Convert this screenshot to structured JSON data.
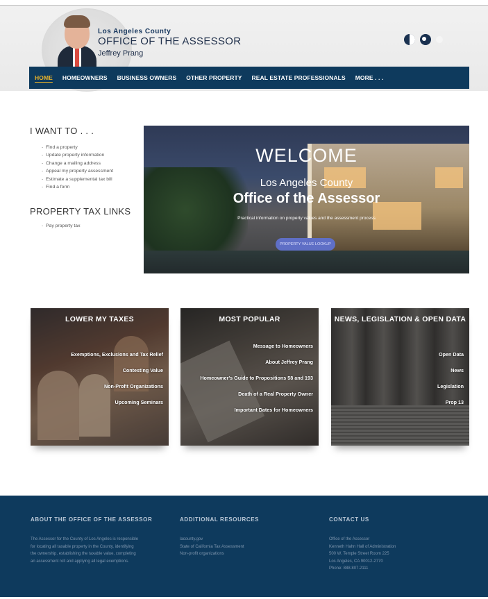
{
  "header": {
    "county": "Los Angeles County",
    "office": "OFFICE OF THE ASSESSOR",
    "assessor_name": "Jeffrey Prang"
  },
  "nav": {
    "items": [
      {
        "label": "HOME",
        "active": true
      },
      {
        "label": "HOMEOWNERS"
      },
      {
        "label": "BUSINESS OWNERS"
      },
      {
        "label": "OTHER PROPERTY"
      },
      {
        "label": "REAL ESTATE PROFESSIONALS"
      },
      {
        "label": "MORE . . ."
      }
    ]
  },
  "want_to": {
    "title": "I WANT TO . . .",
    "items": [
      "Find a property",
      "Update property information",
      "Change a mailing address",
      "Appeal my property assessment",
      "Estimate a supplemental tax bill",
      "Find a form"
    ]
  },
  "property_tax": {
    "title": "PROPERTY TAX LINKS",
    "items": [
      "Pay property tax"
    ]
  },
  "hero": {
    "welcome": "WELCOME",
    "county": "Los Angeles County",
    "office": "Office of the Assessor",
    "description": "Practical information on property values and the assessment process",
    "button": "PROPERTY VALUE LOOKUP"
  },
  "cards": [
    {
      "title": "LOWER MY TAXES",
      "links": [
        "Exemptions, Exclusions and Tax Relief",
        "Contesting Value",
        "Non-Profit Organizations",
        "Upcoming Seminars"
      ]
    },
    {
      "title": "MOST POPULAR",
      "links": [
        "Message to Homeowners",
        "About Jeffrey Prang",
        "Homeowner's Guide to Propositions 58 and 193",
        "Death of a Real Property Owner",
        "Important Dates for Homeowners"
      ]
    },
    {
      "title": "NEWS, LEGISLATION & OPEN DATA",
      "links": [
        "Open Data",
        "News",
        "Legislation",
        "Prop 13"
      ]
    }
  ],
  "footer": {
    "about": {
      "title": "ABOUT THE OFFICE OF THE ASSESSOR",
      "lines": [
        "The Assessor for the County of Los Angeles is responsible",
        "for locating all taxable property in the County, identifying",
        "the ownership, establishing the taxable value, completing",
        "an assessment roll and applying all legal exemptions."
      ]
    },
    "resources": {
      "title": "ADDITIONAL RESOURCES",
      "links": [
        "lacounty.gov",
        "State of California Tax Assessment",
        "Non-profit organizations"
      ]
    },
    "contact": {
      "title": "CONTACT US",
      "lines": [
        "Office of the Assessor",
        "Kenneth Hahn Hall of Administration",
        "500 W. Temple Street Room 225",
        "Los Angeles, CA 90012-2770",
        "Phone: 888.807.2111"
      ]
    }
  },
  "colors": {
    "nav_bg": "#0e3a5d",
    "nav_active": "#e7b12a",
    "footer_bg": "#0e3a5d",
    "hero_button": "#5f6fc6"
  }
}
